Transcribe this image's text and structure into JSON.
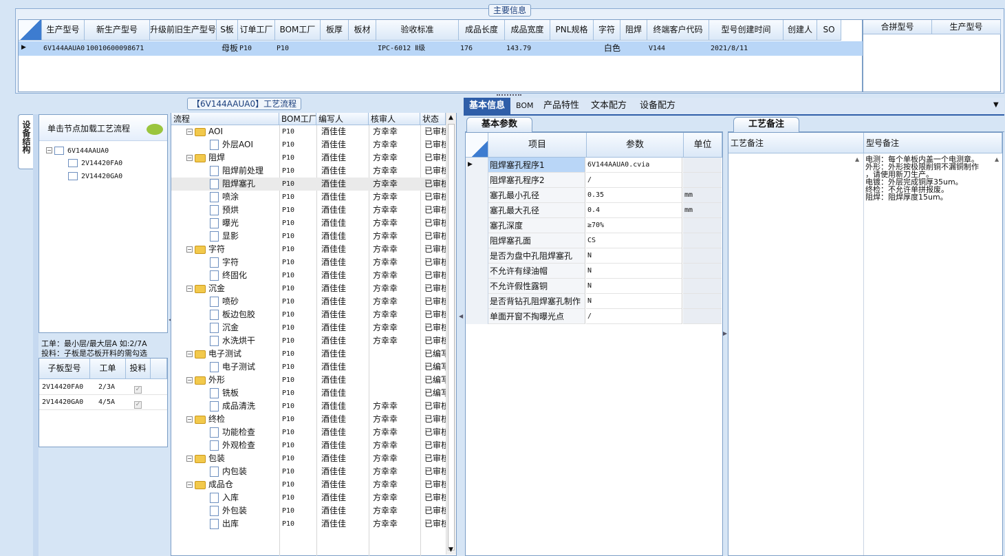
{
  "main_info": {
    "title": "主要信息",
    "columns": [
      "生产型号",
      "新生产型号",
      "升级前旧生产型号",
      "S板",
      "订单工厂",
      "BOM工厂",
      "板厚",
      "板材",
      "验收标准",
      "成品长度",
      "成品宽度",
      "PNL规格",
      "字符",
      "阻焊",
      "终端客户代码",
      "型号创建时间",
      "创建人",
      "SO"
    ],
    "row": {
      "prod_model": "6V144AAUA0",
      "new_model": "10010600098671",
      "old_model": "",
      "s_board": "母板",
      "order_factory": "P10",
      "bom_factory": "P10",
      "thickness": "",
      "material": "",
      "standard": "IPC-6012 Ⅱ级",
      "length": "176",
      "width": "143.79",
      "pnl": "",
      "char": "白色",
      "solder": "",
      "customer_code": "V144",
      "created": "2021/8/11",
      "creator": "",
      "so": ""
    },
    "merge_columns": [
      "合拼型号",
      "生产型号"
    ]
  },
  "side_tab": "设备结构",
  "tree_panel": {
    "hint": "单击节点加载工艺流程",
    "root": "6V144AAUA0",
    "children": [
      "2V14420FA0",
      "2V14420GA0"
    ]
  },
  "sub_board": {
    "note1": "工单：最小层/最大层A 如:2/7A",
    "note2": "投料：子板是芯板开料的需勾选",
    "columns": [
      "子板型号",
      "工单",
      "投料"
    ],
    "rows": [
      {
        "model": "2V14420FA0",
        "order": "2/3A",
        "check": "✓"
      },
      {
        "model": "2V14420GA0",
        "order": "4/5A",
        "check": "✓"
      }
    ]
  },
  "flow": {
    "title": "【6V144AAUA0】工艺流程",
    "columns": [
      "流程",
      "BOM工厂",
      "编写人",
      "核审人",
      "状态"
    ],
    "rows": [
      {
        "type": "folder",
        "name": "AOI",
        "bom": "P10",
        "writer": "酒佳佳",
        "reviewer": "方幸幸",
        "status": "已审核"
      },
      {
        "type": "item",
        "name": "外层AOI",
        "bom": "P10",
        "writer": "酒佳佳",
        "reviewer": "方幸幸",
        "status": "已审核"
      },
      {
        "type": "folder",
        "name": "阻焊",
        "bom": "P10",
        "writer": "酒佳佳",
        "reviewer": "方幸幸",
        "status": "已审核"
      },
      {
        "type": "item",
        "name": "阻焊前处理",
        "bom": "P10",
        "writer": "酒佳佳",
        "reviewer": "方幸幸",
        "status": "已审核"
      },
      {
        "type": "item",
        "name": "阻焊塞孔",
        "bom": "P10",
        "writer": "酒佳佳",
        "reviewer": "方幸幸",
        "status": "已审核",
        "selected": true
      },
      {
        "type": "item",
        "name": "喷涂",
        "bom": "P10",
        "writer": "酒佳佳",
        "reviewer": "方幸幸",
        "status": "已审核"
      },
      {
        "type": "item",
        "name": "预烘",
        "bom": "P10",
        "writer": "酒佳佳",
        "reviewer": "方幸幸",
        "status": "已审核"
      },
      {
        "type": "item",
        "name": "曝光",
        "bom": "P10",
        "writer": "酒佳佳",
        "reviewer": "方幸幸",
        "status": "已审核"
      },
      {
        "type": "item",
        "name": "显影",
        "bom": "P10",
        "writer": "酒佳佳",
        "reviewer": "方幸幸",
        "status": "已审核"
      },
      {
        "type": "folder",
        "name": "字符",
        "bom": "P10",
        "writer": "酒佳佳",
        "reviewer": "方幸幸",
        "status": "已审核"
      },
      {
        "type": "item",
        "name": "字符",
        "bom": "P10",
        "writer": "酒佳佳",
        "reviewer": "方幸幸",
        "status": "已审核"
      },
      {
        "type": "item",
        "name": "终固化",
        "bom": "P10",
        "writer": "酒佳佳",
        "reviewer": "方幸幸",
        "status": "已审核"
      },
      {
        "type": "folder",
        "name": "沉金",
        "bom": "P10",
        "writer": "酒佳佳",
        "reviewer": "方幸幸",
        "status": "已审核"
      },
      {
        "type": "item",
        "name": "喷砂",
        "bom": "P10",
        "writer": "酒佳佳",
        "reviewer": "方幸幸",
        "status": "已审核"
      },
      {
        "type": "item",
        "name": "板边包胶",
        "bom": "P10",
        "writer": "酒佳佳",
        "reviewer": "方幸幸",
        "status": "已审核"
      },
      {
        "type": "item",
        "name": "沉金",
        "bom": "P10",
        "writer": "酒佳佳",
        "reviewer": "方幸幸",
        "status": "已审核"
      },
      {
        "type": "item",
        "name": "水洗烘干",
        "bom": "P10",
        "writer": "酒佳佳",
        "reviewer": "方幸幸",
        "status": "已审核"
      },
      {
        "type": "folder",
        "name": "电子测试",
        "bom": "P10",
        "writer": "酒佳佳",
        "reviewer": "",
        "status": "已编写"
      },
      {
        "type": "item",
        "name": "电子测试",
        "bom": "P10",
        "writer": "酒佳佳",
        "reviewer": "",
        "status": "已编写"
      },
      {
        "type": "folder",
        "name": "外形",
        "bom": "P10",
        "writer": "酒佳佳",
        "reviewer": "",
        "status": "已编写"
      },
      {
        "type": "item",
        "name": "铣板",
        "bom": "P10",
        "writer": "酒佳佳",
        "reviewer": "",
        "status": "已编写"
      },
      {
        "type": "item",
        "name": "成品清洗",
        "bom": "P10",
        "writer": "酒佳佳",
        "reviewer": "方幸幸",
        "status": "已审核"
      },
      {
        "type": "folder",
        "name": "终检",
        "bom": "P10",
        "writer": "酒佳佳",
        "reviewer": "方幸幸",
        "status": "已审核"
      },
      {
        "type": "item",
        "name": "功能检查",
        "bom": "P10",
        "writer": "酒佳佳",
        "reviewer": "方幸幸",
        "status": "已审核"
      },
      {
        "type": "item",
        "name": "外观检查",
        "bom": "P10",
        "writer": "酒佳佳",
        "reviewer": "方幸幸",
        "status": "已审核"
      },
      {
        "type": "folder",
        "name": "包装",
        "bom": "P10",
        "writer": "酒佳佳",
        "reviewer": "方幸幸",
        "status": "已审核"
      },
      {
        "type": "item",
        "name": "内包装",
        "bom": "P10",
        "writer": "酒佳佳",
        "reviewer": "方幸幸",
        "status": "已审核"
      },
      {
        "type": "folder",
        "name": "成品仓",
        "bom": "P10",
        "writer": "酒佳佳",
        "reviewer": "方幸幸",
        "status": "已审核"
      },
      {
        "type": "item",
        "name": "入库",
        "bom": "P10",
        "writer": "酒佳佳",
        "reviewer": "方幸幸",
        "status": "已审核"
      },
      {
        "type": "item",
        "name": "外包装",
        "bom": "P10",
        "writer": "酒佳佳",
        "reviewer": "方幸幸",
        "status": "已审核"
      },
      {
        "type": "item",
        "name": "出库",
        "bom": "P10",
        "writer": "酒佳佳",
        "reviewer": "方幸幸",
        "status": "已审核"
      }
    ]
  },
  "right_tabs": [
    "基本信息",
    "BOM",
    "产品特性",
    "文本配方",
    "设备配方"
  ],
  "basic_params": {
    "tab": "基本参数",
    "columns": [
      "项目",
      "参数",
      "单位"
    ],
    "rows": [
      {
        "item": "阻焊塞孔程序1",
        "value": "6V144AAUA0.cvia",
        "unit": ""
      },
      {
        "item": "阻焊塞孔程序2",
        "value": "/",
        "unit": ""
      },
      {
        "item": "塞孔最小孔径",
        "value": "0.35",
        "unit": "mm"
      },
      {
        "item": "塞孔最大孔径",
        "value": "0.4",
        "unit": "mm"
      },
      {
        "item": "塞孔深度",
        "value": "≥70%",
        "unit": ""
      },
      {
        "item": "阻焊塞孔面",
        "value": "CS",
        "unit": ""
      },
      {
        "item": "是否为盘中孔阻焊塞孔",
        "value": "N",
        "unit": ""
      },
      {
        "item": "不允许有绿油帽",
        "value": "N",
        "unit": ""
      },
      {
        "item": "不允许假性露铜",
        "value": "N",
        "unit": ""
      },
      {
        "item": "是否背钻孔阻焊塞孔制作",
        "value": "N",
        "unit": ""
      },
      {
        "item": "单面开窗不掏曝光点",
        "value": "/",
        "unit": ""
      }
    ]
  },
  "remarks": {
    "tab": "工艺备注",
    "col1": "工艺备注",
    "col2": "型号备注",
    "lines": [
      "电测：每个单板内盖一个电测章。",
      "外形：外形按极限削铜不漏铜制作",
      "，请使用新刀生产。",
      "电镀：外层完成铜厚35um。",
      "终检：不允许单拼报废。",
      "阻焊：阻焊厚度15um。"
    ]
  },
  "colors": {
    "selected_row": "#b9d6f7",
    "header_grad": "#dbe8f7",
    "active_tab": "#2f5ea8",
    "folder": "#f2c94c"
  }
}
